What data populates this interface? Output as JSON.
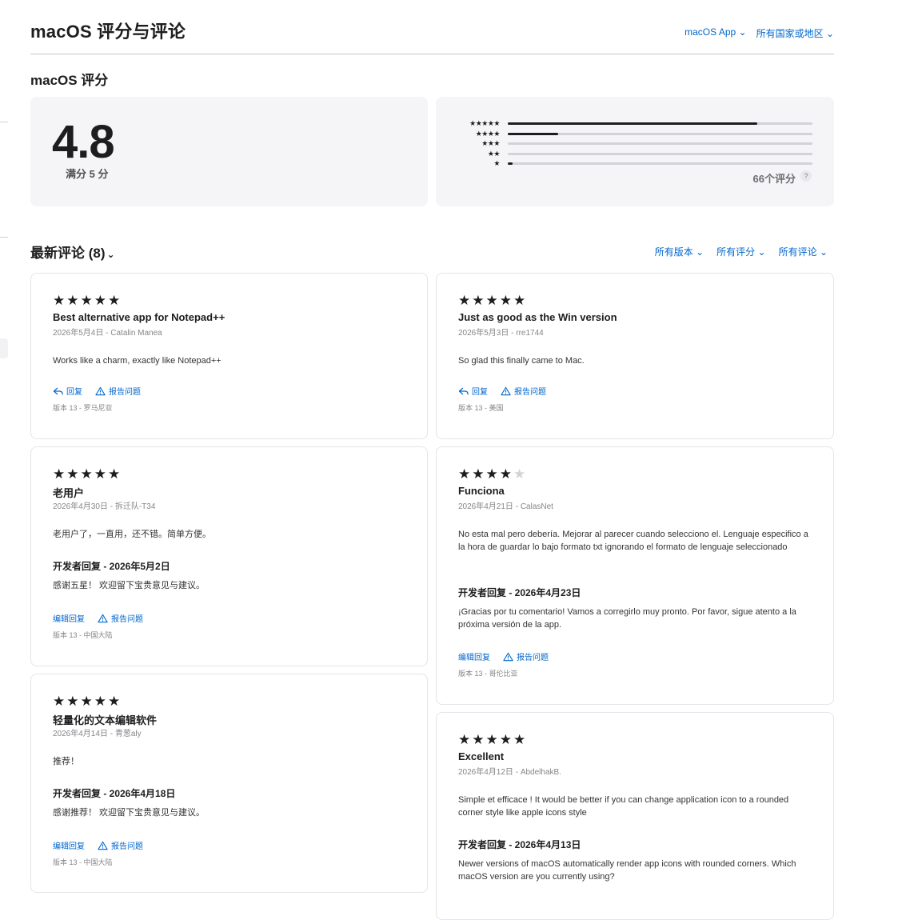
{
  "page": {
    "title": "macOS 评分与评论"
  },
  "top_filters": [
    {
      "label": "macOS App"
    },
    {
      "label": "所有国家或地区"
    }
  ],
  "ratings": {
    "section_title": "macOS 评分",
    "score": "4.8",
    "out_of": "满分 5 分",
    "total": "66个评分",
    "help": "?",
    "distribution": [
      {
        "stars": "★★★★★",
        "fraction": 0.82
      },
      {
        "stars": "★★★★",
        "fraction": 0.165
      },
      {
        "stars": "★★★",
        "fraction": 0.0
      },
      {
        "stars": "★★",
        "fraction": 0.0
      },
      {
        "stars": "★",
        "fraction": 0.015
      }
    ]
  },
  "reviews_section": {
    "title": "最新评论 (8)",
    "filters": [
      {
        "label": "所有版本"
      },
      {
        "label": "所有评分"
      },
      {
        "label": "所有评论"
      }
    ]
  },
  "reviews": [
    {
      "rating": 5,
      "title": "Best alternative app for Notepad++",
      "meta": "2026年5月4日 - Catalin Manea",
      "body": "Works like a charm, exactly like Notepad++",
      "reply_header": "",
      "reply": "",
      "action_reply": "回复",
      "action_report": "报告问题",
      "version": "版本 13 - 罗马尼亚"
    },
    {
      "rating": 5,
      "title": "Just as good as the Win version",
      "meta": "2026年5月3日 - rre1744",
      "body": "So glad this finally came to Mac.",
      "reply_header": "",
      "reply": "",
      "action_reply": "回复",
      "action_report": "报告问题",
      "version": "版本 13 - 美国"
    },
    {
      "rating": 5,
      "title": "老用户",
      "meta": "2026年4月30日 - 拆迁队-T34",
      "body": "老用户了，一直用，还不错。简单方便。",
      "reply_header": "开发者回复 - 2026年5月2日",
      "reply": "感谢五星！ 欢迎留下宝贵意见与建议。",
      "action_reply": "编辑回复",
      "action_report": "报告问题",
      "version": "版本 13 - 中国大陆"
    },
    {
      "rating": 4,
      "title": "Funciona",
      "meta": "2026年4月21日 - CalasNet",
      "body": "No esta mal pero debería. Mejorar al parecer cuando selecciono el. Lenguaje especifico a la hora de guardar lo bajo formato txt ignorando el formato de lenguaje seleccionado",
      "reply_header": "开发者回复 - 2026年4月23日",
      "reply": "¡Gracias por tu comentario! Vamos a corregirlo muy pronto. Por favor, sigue atento a la próxima versión de la app.",
      "action_reply": "编辑回复",
      "action_report": "报告问题",
      "version": "版本 13 - 哥伦比亚"
    },
    {
      "rating": 5,
      "title": "轻量化的文本编辑软件",
      "meta": "2026年4月14日 - 青葱aly",
      "body": "推荐！",
      "reply_header": "开发者回复 - 2026年4月18日",
      "reply": "感谢推荐！ 欢迎留下宝贵意见与建议。",
      "action_reply": "编辑回复",
      "action_report": "报告问题",
      "version": "版本 13 - 中国大陆"
    },
    {
      "rating": 5,
      "title": "Excellent",
      "meta": "2026年4月12日 - AbdelhakB.",
      "body": "Simple et efficace ! It would be better if you can change application icon to a rounded corner style like apple icons style",
      "reply_header": "开发者回复 - 2026年4月13日",
      "reply": "Newer versions of macOS automatically render app icons with rounded corners. Which macOS version are you currently using?",
      "action_reply": "",
      "action_report": "",
      "version": ""
    }
  ]
}
